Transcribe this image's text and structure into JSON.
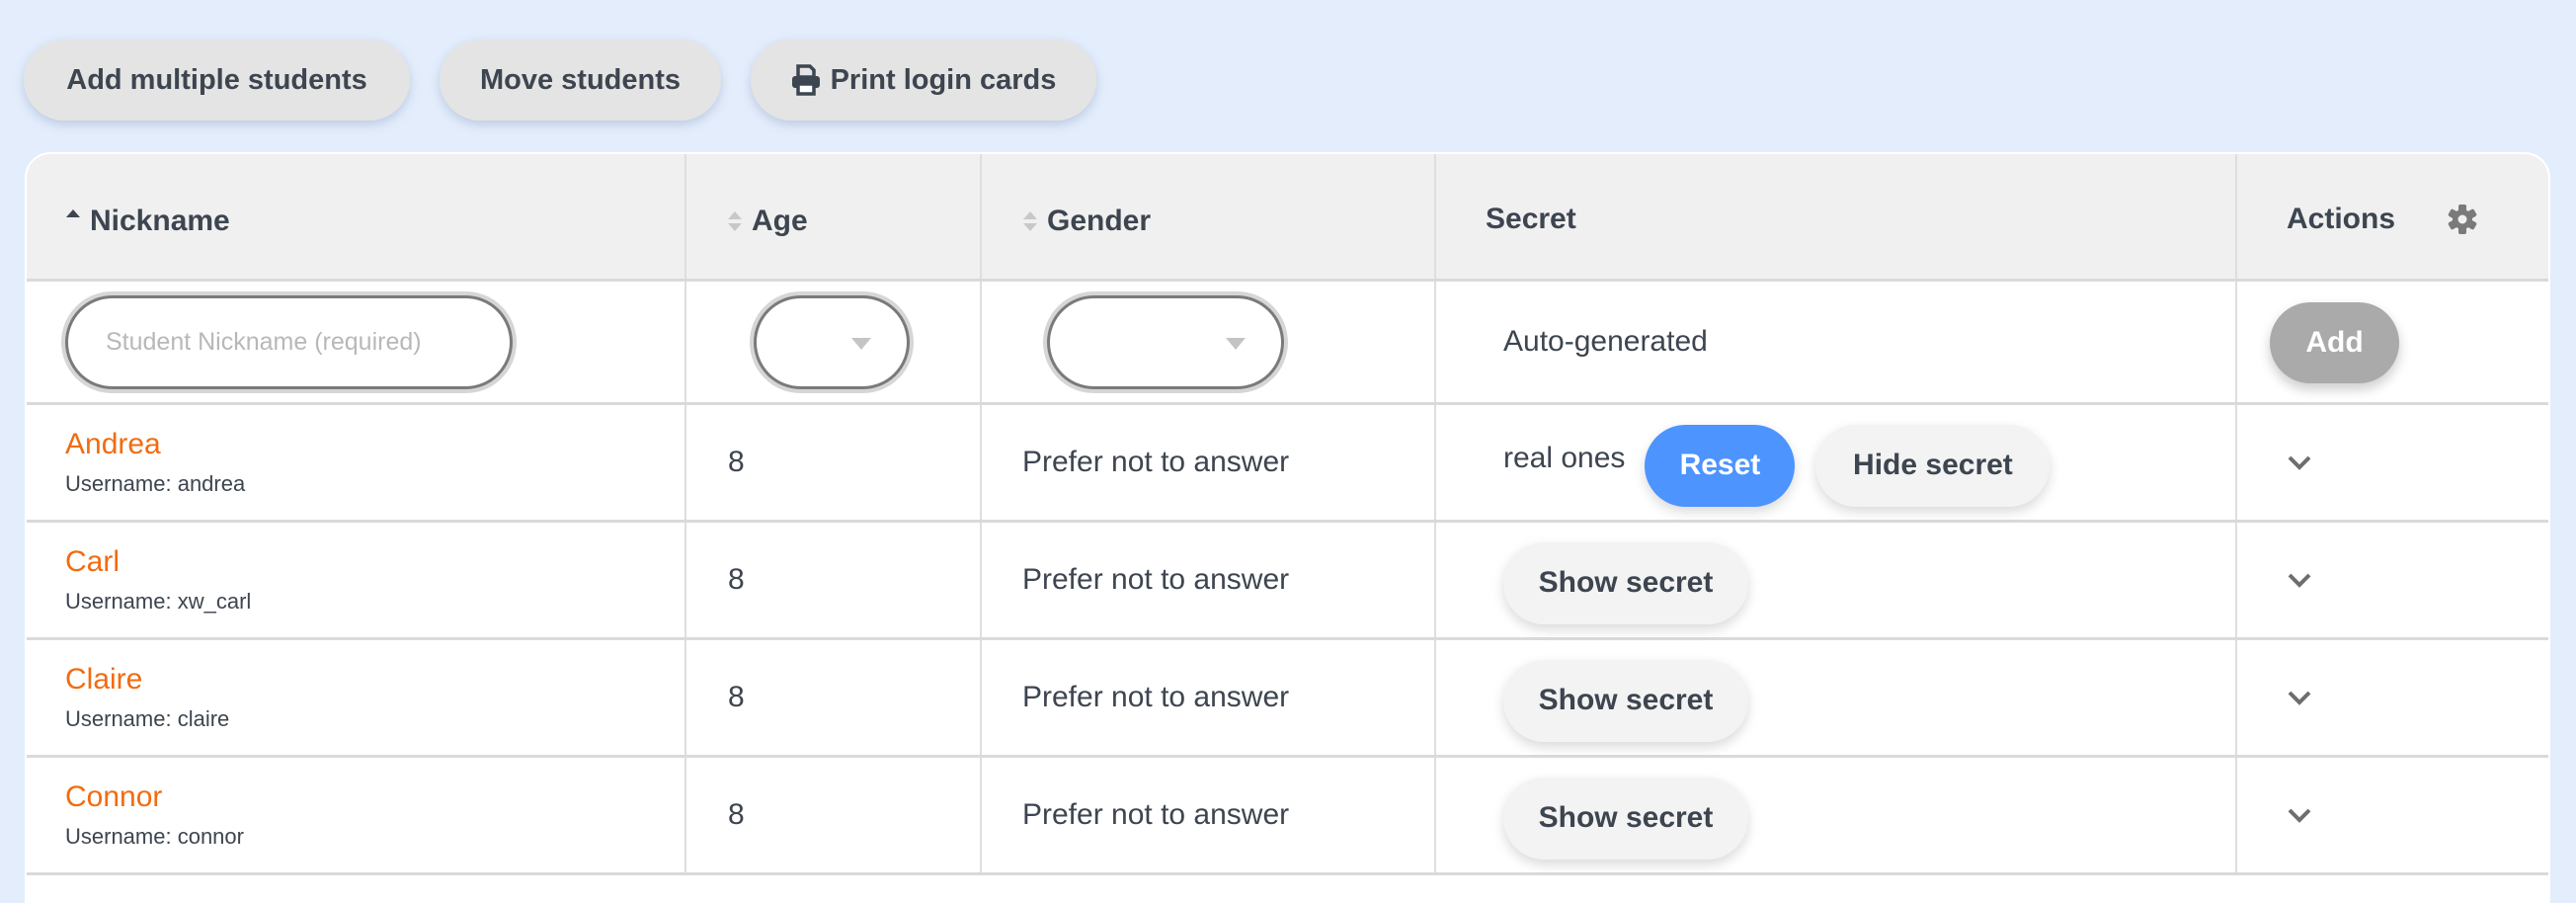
{
  "toolbar": {
    "add_multiple_label": "Add multiple students",
    "move_label": "Move students",
    "print_label": "Print login cards",
    "print_icon": "printer-icon"
  },
  "table": {
    "headers": {
      "nickname": "Nickname",
      "age": "Age",
      "gender": "Gender",
      "secret": "Secret",
      "actions": "Actions"
    },
    "sort": {
      "nickname": "ascending",
      "age": "unsorted",
      "gender": "unsorted"
    },
    "settings_icon": "gear-icon",
    "new_row": {
      "nickname_placeholder": "Student Nickname (required)",
      "nickname_value": "",
      "age_value": "",
      "gender_value": "",
      "secret_text": "Auto-generated",
      "add_label": "Add"
    },
    "rows": [
      {
        "name": "Andrea",
        "username": "Username: andrea",
        "age": "8",
        "gender": "Prefer not to answer",
        "secret": "real ones",
        "reset_label": "Reset",
        "hide_label": "Hide secret"
      },
      {
        "name": "Carl",
        "username": "Username: xw_carl",
        "age": "8",
        "gender": "Prefer not to answer",
        "show_label": "Show secret"
      },
      {
        "name": "Claire",
        "username": "Username: claire",
        "age": "8",
        "gender": "Prefer not to answer",
        "show_label": "Show secret"
      },
      {
        "name": "Connor",
        "username": "Username: connor",
        "age": "8",
        "gender": "Prefer not to answer",
        "show_label": "Show secret"
      }
    ]
  },
  "colors": {
    "background": "#e3edfc",
    "name_link": "#f26b10",
    "reset_button": "#4d94ff",
    "add_button_disabled": "#aaaaaa",
    "text": "#3d4550"
  }
}
